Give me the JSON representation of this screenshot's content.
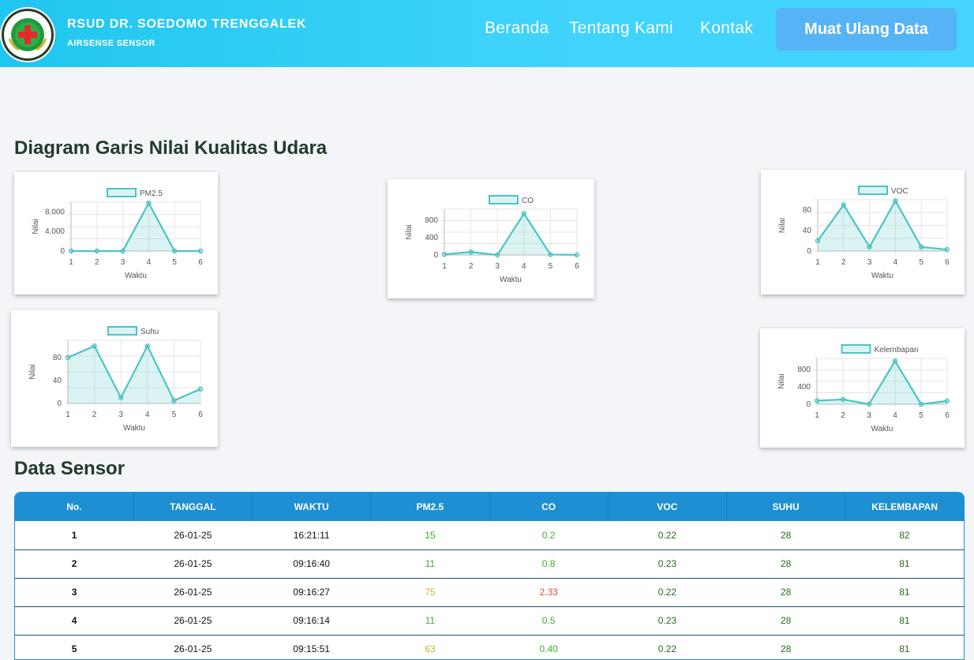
{
  "header": {
    "brand_title": "RSUD DR. SOEDOMO TRENGGALEK",
    "brand_subtitle": "AIRSENSE SENSOR",
    "logo_text": "RSUD Dr. SOEDOMO TRENGGALEK · KABUPATEN TRENGGALEK",
    "nav": [
      "Beranda",
      "Tentang Kami",
      "Kontak"
    ],
    "reload_label": "Muat Ulang Data"
  },
  "charts_title": "Diagram Garis Nilai Kualitas Udara",
  "table_title": "Data Sensor",
  "chart_data": [
    {
      "type": "line",
      "title": "",
      "series": [
        {
          "name": "PM2.5",
          "values": [
            0,
            0,
            0,
            9800,
            0,
            0
          ]
        }
      ],
      "x": [
        1,
        2,
        3,
        4,
        5,
        6
      ],
      "xlabel": "Waktu",
      "ylabel": "Nilai",
      "ylim": [
        0,
        10000
      ],
      "yticks": [
        0,
        4000,
        8000
      ],
      "ytick_labels": [
        "0",
        "4.000",
        "8.000"
      ],
      "grid": true,
      "legend": "top-center"
    },
    {
      "type": "line",
      "title": "",
      "series": [
        {
          "name": "CO",
          "values": [
            15,
            70,
            0,
            950,
            10,
            5
          ]
        }
      ],
      "x": [
        1,
        2,
        3,
        4,
        5,
        6
      ],
      "xlabel": "Waktu",
      "ylabel": "Nilai",
      "ylim": [
        0,
        1050
      ],
      "yticks": [
        0,
        400,
        800
      ],
      "ytick_labels": [
        "0",
        "400",
        "800"
      ],
      "grid": true,
      "legend": "top-center"
    },
    {
      "type": "line",
      "title": "",
      "series": [
        {
          "name": "VOC",
          "values": [
            20,
            90,
            8,
            98,
            8,
            3
          ]
        }
      ],
      "x": [
        1,
        2,
        3,
        4,
        5,
        6
      ],
      "xlabel": "Waktu",
      "ylabel": "Nilai",
      "ylim": [
        0,
        100
      ],
      "yticks": [
        0,
        40,
        80
      ],
      "ytick_labels": [
        "0",
        "40",
        "80"
      ],
      "grid": true,
      "legend": "top-center"
    },
    {
      "type": "line",
      "title": "",
      "series": [
        {
          "name": "Suhu",
          "values": [
            80,
            100,
            10,
            100,
            5,
            25
          ]
        }
      ],
      "x": [
        1,
        2,
        3,
        4,
        5,
        6
      ],
      "xlabel": "Waktu",
      "ylabel": "Nilai",
      "ylim": [
        0,
        110
      ],
      "yticks": [
        0,
        40,
        80
      ],
      "ytick_labels": [
        "0",
        "40",
        "80"
      ],
      "grid": true,
      "legend": "top-center"
    },
    {
      "type": "line",
      "title": "",
      "series": [
        {
          "name": "Kelembapan",
          "values": [
            80,
            110,
            0,
            990,
            0,
            75
          ]
        }
      ],
      "x": [
        1,
        2,
        3,
        4,
        5,
        6
      ],
      "xlabel": "Waktu",
      "ylabel": "Nilai",
      "ylim": [
        0,
        1050
      ],
      "yticks": [
        0,
        400,
        800
      ],
      "ytick_labels": [
        "0",
        "400",
        "800"
      ],
      "grid": true,
      "legend": "top-center"
    }
  ],
  "table": {
    "headers": [
      "No.",
      "TANGGAL",
      "WAKTU",
      "PM2.5",
      "CO",
      "VOC",
      "SUHU",
      "KELEMBAPAN"
    ],
    "rows": [
      [
        "1",
        "26-01-25",
        "16:21:11",
        "15",
        "0.2",
        "0.22",
        "28",
        "82"
      ],
      [
        "2",
        "26-01-25",
        "09:16:40",
        "11",
        "0.8",
        "0.23",
        "28",
        "81"
      ],
      [
        "3",
        "26-01-25",
        "09:16:27",
        "75",
        "2.33",
        "0.22",
        "28",
        "81"
      ],
      [
        "4",
        "26-01-25",
        "09:16:14",
        "11",
        "0.5",
        "0.23",
        "28",
        "81"
      ],
      [
        "5",
        "26-01-25",
        "09:15:51",
        "63",
        "0.40",
        "0.22",
        "28",
        "81"
      ]
    ]
  },
  "colors": {
    "header_start": "#1fc6ef",
    "header_end": "#44d4fd",
    "button": "#56b3f5",
    "line": "#4cc4c4",
    "table_header": "#1d8fd2",
    "good": "#3cae2a",
    "moderate": "#d2b32e",
    "bad": "#e24a3e",
    "dark_good": "#2a6a1c"
  }
}
